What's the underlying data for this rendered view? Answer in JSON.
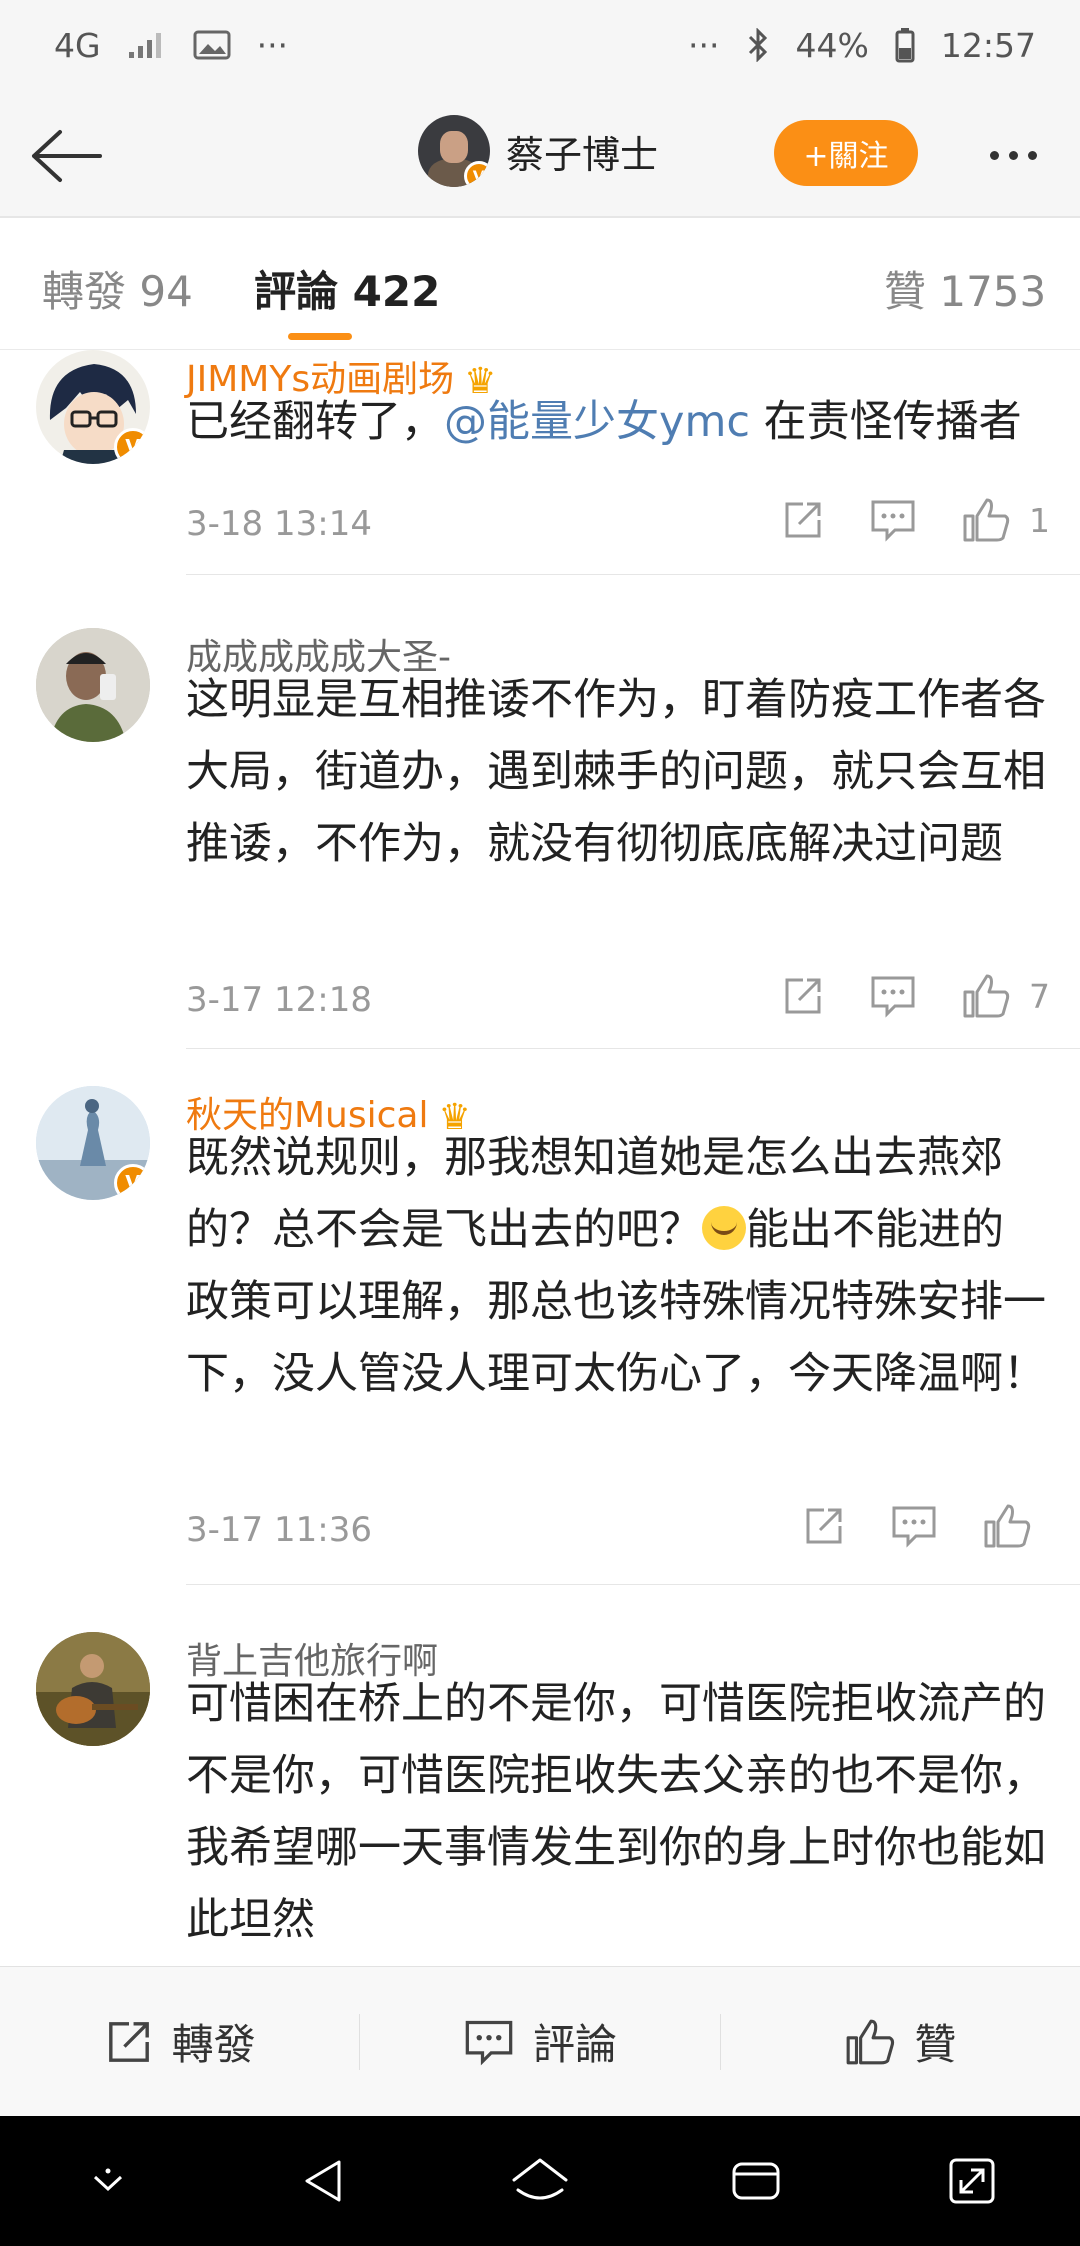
{
  "status_bar": {
    "network": "4G",
    "dots_left": "···",
    "dots_right": "···",
    "battery": "44%",
    "time": "12:57"
  },
  "header": {
    "user_name": "蔡子博士",
    "follow_label": "+關注"
  },
  "tabs": [
    {
      "label": "轉發 94"
    },
    {
      "label": "評論 422"
    },
    {
      "label": "贊 1753"
    }
  ],
  "comments": [
    {
      "name": "JIMMYs动画剧场",
      "text_before": "已经翻转了，",
      "mention": "@能量少女ymc",
      "text_after": " 在责怪传播者",
      "time": "3-18 13:14",
      "likes": "1"
    },
    {
      "name": "成成成成成大圣-",
      "text": "这明显是互相推诿不作为，盯着防疫工作者各大局，街道办，遇到棘手的问题，就只会互相推诿，不作为，就没有彻彻底底解决过问题",
      "time": "3-17 12:18",
      "likes": "7"
    },
    {
      "name": "秋天的Musical",
      "text_before": "既然说规则，那我想知道她是怎么出去燕郊的？总不会是飞出去的吧？",
      "text_after": "能出不能进的政策可以理解，那总也该特殊情况特殊安排一下，没人管没人理可太伤心了，今天降温啊！",
      "time": "3-17 11:36",
      "likes": ""
    },
    {
      "name": "背上吉他旅行啊",
      "text": "可惜困在桥上的不是你，可惜医院拒收流产的不是你，可惜医院拒收失去父亲的也不是你，我希望哪一天事情发生到你的身上时你也能如此坦然"
    }
  ],
  "bottom_bar": {
    "repost": "轉發",
    "comment": "評論",
    "like": "贊"
  },
  "colors": {
    "accent": "#fb8f15",
    "vip_name": "#ef7a10",
    "mention": "#4f7db2"
  }
}
